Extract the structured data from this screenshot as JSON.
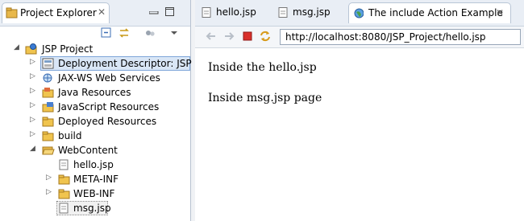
{
  "explorer": {
    "tab_label": "Project Explorer",
    "close_glyph": "✕",
    "tree": [
      {
        "label": "JSP Project",
        "icon": "project-icon",
        "expanded": true
      },
      {
        "label": "Deployment Descriptor: JSP P",
        "icon": "deployment-descriptor-icon"
      },
      {
        "label": "JAX-WS Web Services",
        "icon": "web-services-icon"
      },
      {
        "label": "Java Resources",
        "icon": "java-resources-icon"
      },
      {
        "label": "JavaScript Resources",
        "icon": "javascript-resources-icon"
      },
      {
        "label": "Deployed Resources",
        "icon": "deployed-resources-icon"
      },
      {
        "label": "build",
        "icon": "folder-icon"
      },
      {
        "label": "WebContent",
        "icon": "folder-open-icon",
        "expanded": true
      },
      {
        "label": "hello.jsp",
        "icon": "jsp-file-icon"
      },
      {
        "label": "META-INF",
        "icon": "folder-icon"
      },
      {
        "label": "WEB-INF",
        "icon": "folder-icon"
      },
      {
        "label": "msg.jsp",
        "icon": "jsp-file-icon"
      }
    ]
  },
  "editor": {
    "tabs": [
      {
        "label": "hello.jsp",
        "icon": "jsp-file-icon"
      },
      {
        "label": "msg.jsp",
        "icon": "jsp-file-icon"
      },
      {
        "label": "The include Action Example",
        "icon": "globe-icon",
        "active": true
      }
    ],
    "close_glyph": "✕",
    "url": "http://localhost:8080/JSP_Project/hello.jsp",
    "content_lines": [
      "Inside the hello.jsp",
      "Inside msg.jsp page"
    ]
  },
  "colors": {
    "selection": "#d9e6f6",
    "folder": "#e8b84a",
    "stop": "#d9302b"
  }
}
